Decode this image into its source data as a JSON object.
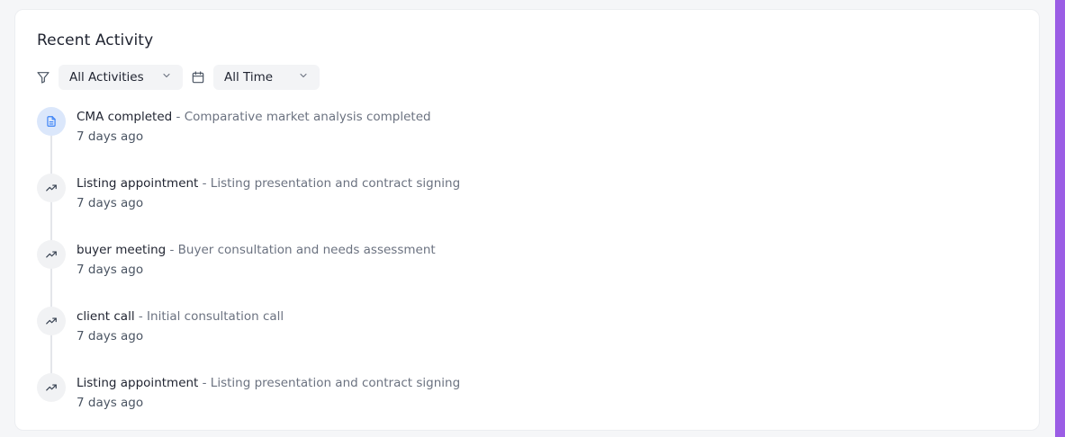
{
  "card": {
    "title": "Recent Activity"
  },
  "filters": {
    "activity_filter": "All Activities",
    "time_filter": "All Time"
  },
  "activities": [
    {
      "title": "CMA completed",
      "description": " - Comparative market analysis completed",
      "time": "7 days ago",
      "icon": "document-icon"
    },
    {
      "title": "Listing appointment",
      "description": " - Listing presentation and contract signing",
      "time": "7 days ago",
      "icon": "trending-up-icon"
    },
    {
      "title": "buyer meeting",
      "description": " - Buyer consultation and needs assessment",
      "time": "7 days ago",
      "icon": "trending-up-icon"
    },
    {
      "title": "client call",
      "description": " - Initial consultation call",
      "time": "7 days ago",
      "icon": "trending-up-icon"
    },
    {
      "title": "Listing appointment",
      "description": " - Listing presentation and contract signing",
      "time": "7 days ago",
      "icon": "trending-up-icon"
    }
  ],
  "colors": {
    "accent": "#9b5de5",
    "doc_icon_bg": "#dbe7fb",
    "doc_icon_stroke": "#3b82f6"
  }
}
